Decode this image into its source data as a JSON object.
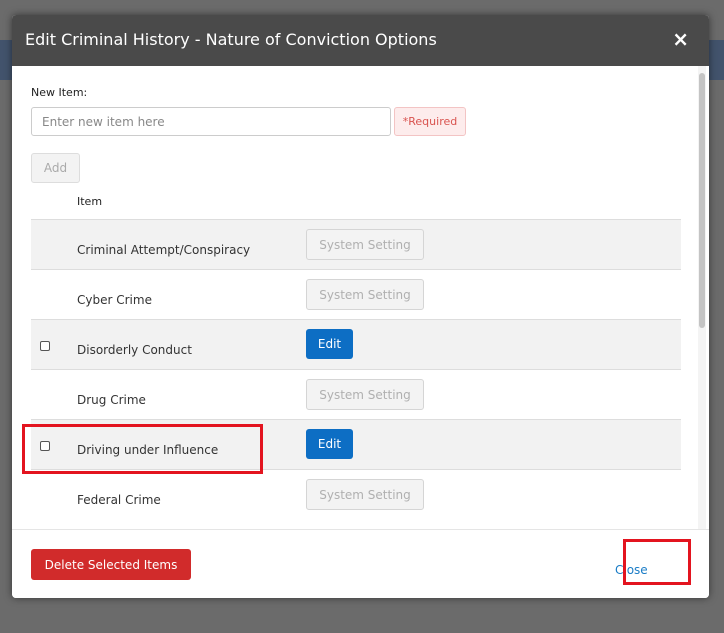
{
  "modal": {
    "title": "Edit Criminal History - Nature of Conviction Options",
    "close_icon": "×"
  },
  "form": {
    "new_item_label": "New Item:",
    "input_placeholder": "Enter new item here",
    "input_value": "",
    "required_text": "*Required",
    "add_label": "Add"
  },
  "list": {
    "column_header": "Item",
    "items": [
      {
        "label": "Criminal Attempt/Conspiracy",
        "action": "System Setting",
        "checkbox": false
      },
      {
        "label": "Cyber Crime",
        "action": "System Setting",
        "checkbox": false
      },
      {
        "label": "Disorderly Conduct",
        "action": "Edit",
        "checkbox": true
      },
      {
        "label": "Drug Crime",
        "action": "System Setting",
        "checkbox": false
      },
      {
        "label": "Driving under Influence",
        "action": "Edit",
        "checkbox": true
      },
      {
        "label": "Federal Crime",
        "action": "System Setting",
        "checkbox": false
      }
    ]
  },
  "footer": {
    "delete_label": "Delete Selected Items",
    "close_label": "Close"
  },
  "colors": {
    "header_bg": "#4a4a4a",
    "edit_button": "#0d6ec4",
    "delete_button": "#d12b2b",
    "highlight": "#e3141f",
    "link": "#1a7cc6"
  }
}
